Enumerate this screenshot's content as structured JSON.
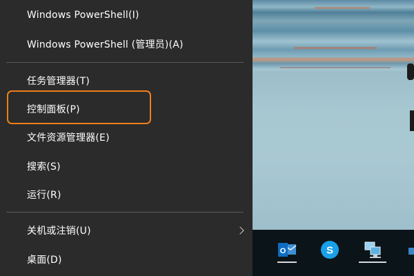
{
  "context_menu": {
    "items": [
      {
        "label": "Windows PowerShell(I)"
      },
      {
        "label": "Windows PowerShell (管理员)(A)"
      },
      {
        "label": "任务管理器(T)"
      },
      {
        "label": "控制面板(P)"
      },
      {
        "label": "文件资源管理器(E)"
      },
      {
        "label": "搜索(S)"
      },
      {
        "label": "运行(R)"
      },
      {
        "label": "关机或注销(U)",
        "has_submenu": true
      },
      {
        "label": "桌面(D)"
      }
    ],
    "highlighted_item": "控制面板(P)",
    "highlight_color": "#f07f1a",
    "background_color": "#2b2b2b"
  },
  "taskbar": {
    "icons": [
      {
        "name": "outlook-icon",
        "letter": "O"
      },
      {
        "name": "skype-icon",
        "letter": "S"
      },
      {
        "name": "network-computer-icon"
      }
    ]
  }
}
